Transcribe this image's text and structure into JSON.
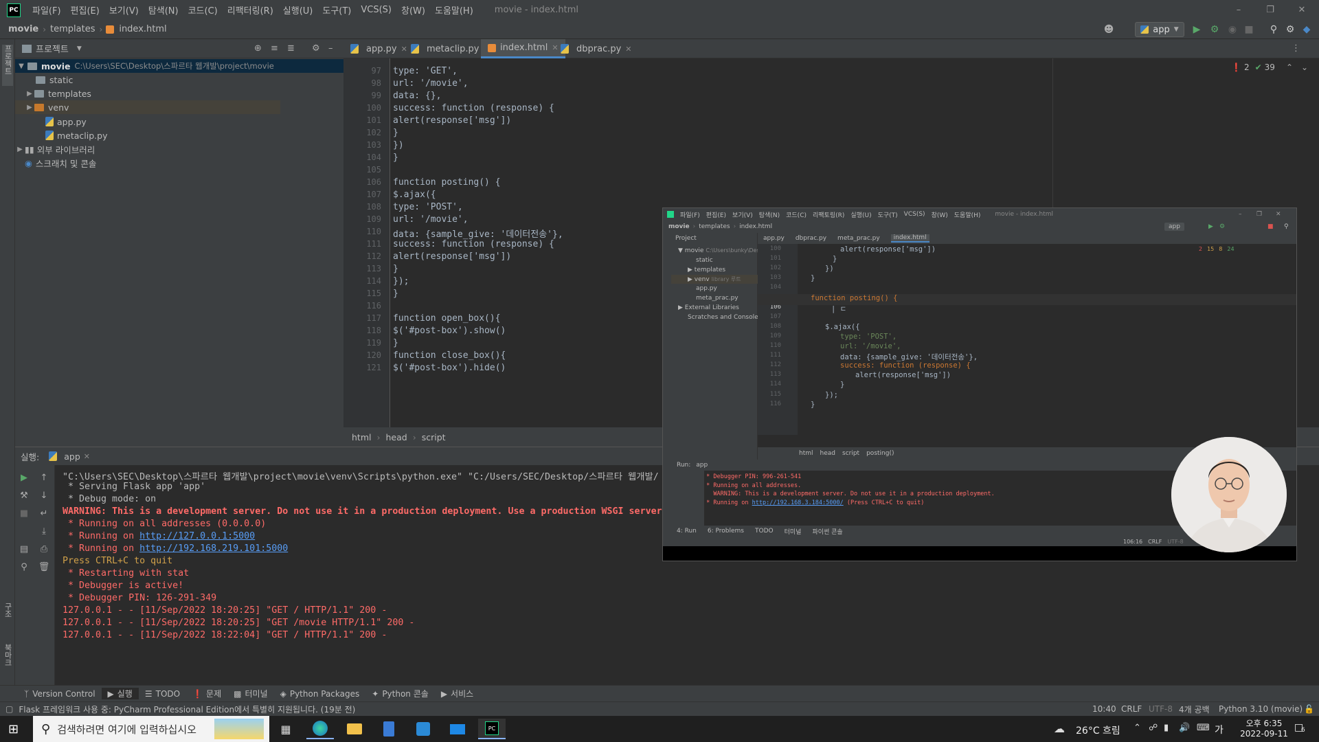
{
  "menubar": {
    "logo": "PC",
    "items": [
      "파일(F)",
      "편집(E)",
      "보기(V)",
      "탐색(N)",
      "코드(C)",
      "리팩터링(R)",
      "실행(U)",
      "도구(T)",
      "VCS(S)",
      "창(W)",
      "도움말(H)"
    ],
    "window_title": "movie - index.html"
  },
  "navbar": {
    "crumbs": [
      "movie",
      "templates",
      "index.html"
    ],
    "run_config": "app"
  },
  "left_strip": {
    "project_tab": "프로젝트",
    "structure_tab": "구조",
    "bookmarks_tab": "북마크"
  },
  "project": {
    "header": "프로젝트",
    "root_name": "movie",
    "root_path": "C:\\Users\\SEC\\Desktop\\스파르타 웹개발\\project\\movie",
    "items": [
      "static",
      "templates",
      "venv",
      "app.py",
      "metaclip.py"
    ],
    "external": "외부 라이브러리",
    "scratches": "스크래치 및 콘솔"
  },
  "editor": {
    "tabs": [
      "app.py",
      "metaclip.py",
      "index.html",
      "dbprac.py"
    ],
    "active_tab": "index.html",
    "inspections": {
      "errors": "2",
      "ok": "39"
    },
    "line_numbers": [
      "97",
      "98",
      "99",
      "100",
      "101",
      "102",
      "103",
      "104",
      "105",
      "106",
      "107",
      "108",
      "109",
      "110",
      "111",
      "112",
      "113",
      "114",
      "115",
      "116",
      "117",
      "118",
      "119",
      "120",
      "121"
    ],
    "lines": [
      "type: 'GET',",
      "url: '/movie',",
      "data: {},",
      "success: function (response) {",
      "alert(response['msg'])",
      "}",
      "})",
      "}",
      "",
      "function posting() {",
      "$.ajax({",
      "type: 'POST',",
      "url: '/movie',",
      "data: {sample_give: '데이터전송'},",
      "success: function (response) {",
      "alert(response['msg'])",
      "}",
      "});",
      "}",
      "",
      "function open_box(){",
      "$('#post-box').show()",
      "}",
      "function close_box(){",
      "$('#post-box').hide()"
    ],
    "breadcrumb": [
      "html",
      "head",
      "script"
    ]
  },
  "run": {
    "label": "실행:",
    "tab": "app",
    "lines": [
      {
        "t": "\"C:\\Users\\SEC\\Desktop\\스파르타 웹개발\\project\\movie\\venv\\Scripts\\python.exe\" \"C:/Users/SEC/Desktop/스파르타 웹개발/",
        "c": "#bbbbbb"
      },
      {
        "t": " * Serving Flask app 'app'",
        "c": "#bbbbbb"
      },
      {
        "t": " * Debug mode: on",
        "c": "#bbbbbb"
      },
      {
        "t": "WARNING: This is a development server. Do not use it in a production deployment. Use a production WSGI server",
        "c": "#ff6b68",
        "b": true
      },
      {
        "t": " * Running on all addresses (0.0.0.0)",
        "c": "#ff6b68"
      },
      {
        "t": " * Running on ",
        "c": "#ff6b68",
        "link": "http://127.0.0.1:5000"
      },
      {
        "t": " * Running on ",
        "c": "#ff6b68",
        "link": "http://192.168.219.101:5000"
      },
      {
        "t": "Press CTRL+C to quit",
        "c": "#d1a14a"
      },
      {
        "t": " * Restarting with stat",
        "c": "#ff6b68"
      },
      {
        "t": " * Debugger is active!",
        "c": "#ff6b68"
      },
      {
        "t": " * Debugger PIN: 126-291-349",
        "c": "#ff6b68"
      },
      {
        "t": "127.0.0.1 - - [11/Sep/2022 18:20:25] \"GET / HTTP/1.1\" 200 -",
        "c": "#ff6b68"
      },
      {
        "t": "127.0.0.1 - - [11/Sep/2022 18:20:25] \"GET /movie HTTP/1.1\" 200 -",
        "c": "#ff6b68"
      },
      {
        "t": "127.0.0.1 - - [11/Sep/2022 18:22:04] \"GET / HTTP/1.1\" 200 -",
        "c": "#ff6b68"
      }
    ]
  },
  "toolwindows": [
    "Version Control",
    "실행",
    "TODO",
    "문제",
    "터미널",
    "Python Packages",
    "Python 콘솔",
    "서비스"
  ],
  "status": {
    "message": "Flask 프레임워크 사용 중: PyCharm Professional Edition에서 특별히 지원됩니다. (19분 전)",
    "position": "10:40",
    "line_sep": "CRLF",
    "encoding": "UTF-8",
    "indent": "4개 공백",
    "interpreter": "Python 3.10 (movie)"
  },
  "taskbar": {
    "search_placeholder": "검색하려면 여기에 입력하십시오",
    "weather": "26°C 흐림",
    "ime": "가",
    "time": "오후 6:35",
    "date": "2022-09-11",
    "notif_count": "6"
  },
  "overlay": {
    "menu": [
      "파일(F)",
      "편집(E)",
      "보기(V)",
      "탐색(N)",
      "코드(C)",
      "리팩토링(R)",
      "실행(U)",
      "도구(T)",
      "VCS(S)",
      "창(W)",
      "도움말(H)"
    ],
    "title": "movie - index.html",
    "crumbs": [
      "movie",
      "templates",
      "index.html"
    ],
    "run_config": "app",
    "project_label": "Project",
    "tabs": [
      "app.py",
      "dbprac.py",
      "meta_prac.py",
      "index.html"
    ],
    "tree": [
      "movie",
      "static",
      "templates",
      "venv",
      "app.py",
      "meta_prac.py",
      "External Libraries",
      "Scratches and Consoles"
    ],
    "tree_root_path": "C:\\Users\\bunky\\Desk",
    "venv_hint": "library 루트",
    "inspections": [
      "2",
      "15",
      "8",
      "24"
    ],
    "line_numbers": [
      "100",
      "101",
      "102",
      "103",
      "104",
      "105",
      "106",
      "107",
      "108",
      "109",
      "110",
      "111",
      "112",
      "113",
      "114",
      "115",
      "116"
    ],
    "breadcrumb": [
      "html",
      "head",
      "script",
      "posting()"
    ],
    "run_label": "Run:",
    "run_tab": "app",
    "console": [
      " * Debugger PIN: 996-261-541",
      " * Running on all addresses.",
      "   WARNING: This is a development server. Do not use it in a production deployment.",
      " * Running on "
    ],
    "console_link": "http://192.168.3.184:5000/",
    "console_tail": " (Press CTRL+C to quit)",
    "bottom_tabs": [
      "4: Run",
      "6: Problems",
      "TODO",
      "터미널",
      "파이썬 콘솔"
    ],
    "status_pos": "106:16",
    "status_sep": "CRLF",
    "status_enc": "UTF-8"
  }
}
